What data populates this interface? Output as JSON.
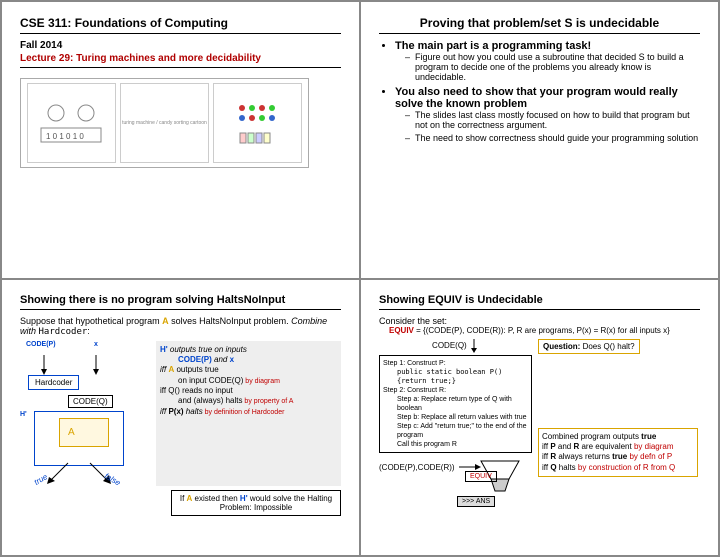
{
  "s1": {
    "course": "CSE 311: Foundations of Computing",
    "term": "Fall 2014",
    "lecture": "Lecture 29: Turing machines and more decidability",
    "img_hint": "turing machine / candy sorting cartoon"
  },
  "s2": {
    "title": "Proving that problem/set S is undecidable",
    "b1": "The main part is a programming task!",
    "b1a": "Figure out how you could use a subroutine that decided S to build a program to decide one of the problems you already know is undecidable.",
    "b2": "You also need to show that your program would really solve the known problem",
    "b2a": "The slides last class mostly focused on how to build that program but not on the correctness argument.",
    "b2b": "The need to show correctness should guide your programming solution"
  },
  "s3": {
    "title": "Showing there is no program solving HaltsNoInput",
    "intro1": "Suppose that hypothetical program ",
    "intro2": " solves HaltsNoInput problem.   ",
    "intro3": "Combine with ",
    "code_p": "CODE(P)",
    "x": "x",
    "hardcoder": "Hardcoder",
    "code_q": "CODE(Q)",
    "hprime": "H'",
    "A": "A",
    "true": "true",
    "false": "false",
    "p_hdr": " outputs true on inputs",
    "p_l2a": " and ",
    "p_iff1": " outputs true",
    "p_iff1b": "on input CODE(Q)",
    "p_iff1r": " by diagram",
    "p_iff2": "iff Q() reads no input",
    "p_iff2b": "and (always) halts",
    "p_iff2r": " by property of A",
    "p_iff3a": "iff ",
    "p_iff3b": "P(x)",
    "p_iff3c": " halts",
    "p_iff3r": " by definition of Hardcoder",
    "halt1": "If ",
    "halt2": " existed then ",
    "halt3": " would solve the Halting Problem:   Impossible"
  },
  "s4": {
    "title": "Showing EQUIV is Undecidable",
    "consider": "Consider the set:",
    "equiv_def": "EQUIV = {(CODE(P), CODE(R)): P, R are programs, P(x) = R(x) for all inputs x}",
    "code_q": "CODE(Q)",
    "question_lbl": "Question:",
    "question": " Does Q() halt?",
    "step1": "Step 1: Construct P:",
    "step1code": "public static boolean P() {return true;}",
    "step2": "Step 2: Construct R:",
    "step2a": "Step a: Replace return type of Q with boolean",
    "step2b": "Step b: Replace all return values with true",
    "step2c": "Step c: Add \"return true;\" to the end of the program",
    "step2d": "Call this program R",
    "pair": "(CODE(P),CODE(R))",
    "equiv": "EQUIV",
    "ans": ">>> ANS",
    "c_hdr": "Combined program outputs ",
    "c_true": "true",
    "c_l1a": "iff ",
    "c_l1b": "P",
    "c_l1c": " and ",
    "c_l1d": "R",
    "c_l1e": " are equivalent",
    "c_l1r": " by diagram",
    "c_l2a": "iff ",
    "c_l2b": "R",
    "c_l2c": " always returns ",
    "c_l2d": "true",
    "c_l2r": " by defn of P",
    "c_l3a": "iff ",
    "c_l3b": "Q",
    "c_l3c": " halts",
    "c_l3r": " by construction of R from Q"
  }
}
